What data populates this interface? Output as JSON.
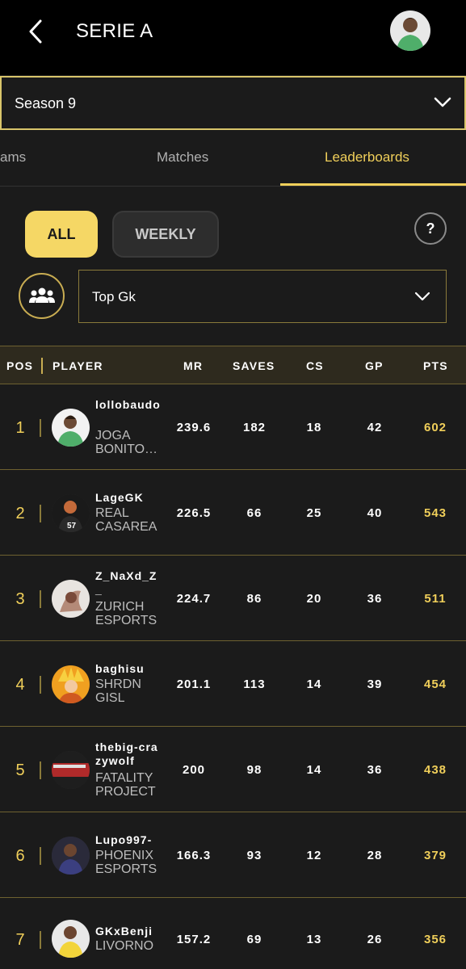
{
  "header": {
    "title": "SERIE A"
  },
  "season": {
    "value": "Season 9"
  },
  "tabs": [
    {
      "label": "ams"
    },
    {
      "label": "Matches"
    },
    {
      "label": "Leaderboards"
    }
  ],
  "filters": {
    "all": "ALL",
    "weekly": "WEEKLY",
    "help": "?"
  },
  "category": {
    "value": "Top Gk"
  },
  "table": {
    "headers": {
      "pos": "POS",
      "player": "PLAYER",
      "mr": "MR",
      "saves": "SAVES",
      "cs": "CS",
      "gp": "GP",
      "pts": "PTS"
    },
    "rows": [
      {
        "pos": "1",
        "name": "lollobaudo",
        "team": "JOGA BONITO…",
        "mr": "239.6",
        "saves": "182",
        "cs": "18",
        "gp": "42",
        "pts": "602"
      },
      {
        "pos": "2",
        "name": "LageGK",
        "team": "REAL CASAREA",
        "mr": "226.5",
        "saves": "66",
        "cs": "25",
        "gp": "40",
        "pts": "543"
      },
      {
        "pos": "3",
        "name": "Z_NaXd_Z_",
        "team": "ZURICH ESPORTS",
        "mr": "224.7",
        "saves": "86",
        "cs": "20",
        "gp": "36",
        "pts": "511"
      },
      {
        "pos": "4",
        "name": "baghisu",
        "team": "SHRDN GISL",
        "mr": "201.1",
        "saves": "113",
        "cs": "14",
        "gp": "39",
        "pts": "454"
      },
      {
        "pos": "5",
        "name": "thebig-crazywolf",
        "team": "FATALITY PROJECT",
        "mr": "200",
        "saves": "98",
        "cs": "14",
        "gp": "36",
        "pts": "438"
      },
      {
        "pos": "6",
        "name": "Lupo997-",
        "team": "PHOENIX ESPORTS",
        "mr": "166.3",
        "saves": "93",
        "cs": "12",
        "gp": "28",
        "pts": "379"
      },
      {
        "pos": "7",
        "name": "GKxBenji",
        "team": "LIVORNO",
        "mr": "157.2",
        "saves": "69",
        "cs": "13",
        "gp": "26",
        "pts": "356"
      }
    ]
  },
  "colors": {
    "accent": "#f0cf5a",
    "background": "#1b1b1b",
    "header_bg": "#000000"
  }
}
